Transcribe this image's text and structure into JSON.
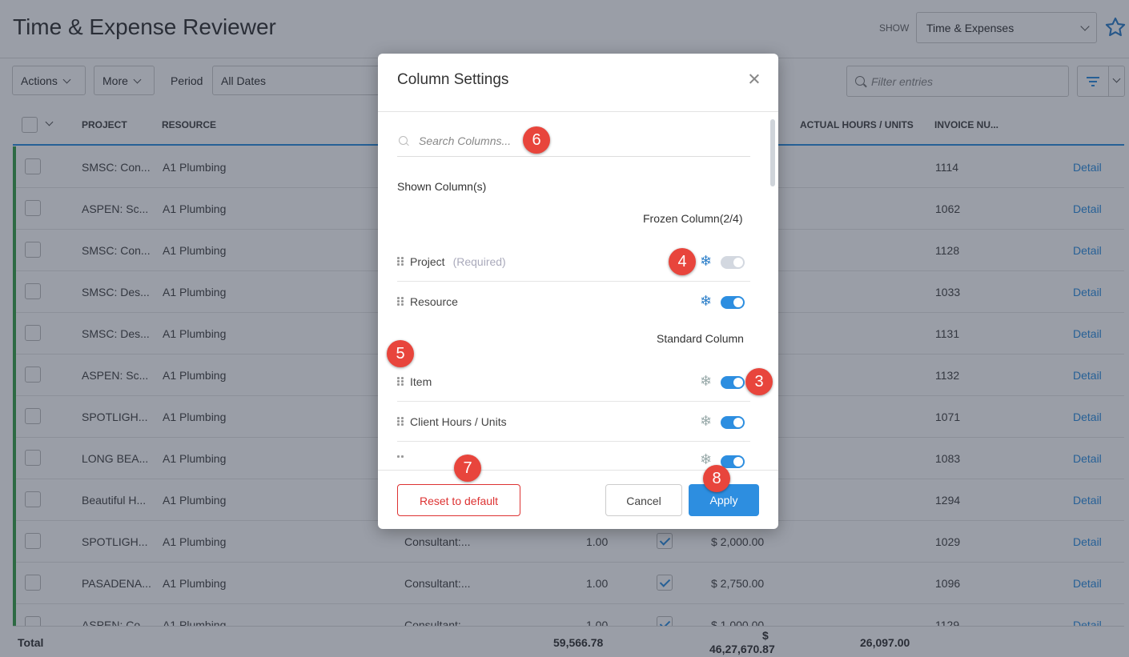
{
  "header": {
    "title": "Time & Expense Reviewer",
    "show_label": "SHOW",
    "show_value": "Time & Expenses"
  },
  "toolbar": {
    "actions_label": "Actions",
    "more_label": "More",
    "period_label": "Period",
    "period_value": "All Dates",
    "filter_placeholder": "Filter entries"
  },
  "table": {
    "columns": {
      "project": "PROJECT",
      "resource": "RESOURCE",
      "actual_hours": "ACTUAL HOURS / UNITS",
      "invoice": "INVOICE NU..."
    },
    "rows": [
      {
        "project": "SMSC: Con...",
        "resource": "A1 Plumbing",
        "item": "",
        "hours": "",
        "amount": "",
        "invoice": "1114",
        "link": "Detail"
      },
      {
        "project": "ASPEN: Sc...",
        "resource": "A1 Plumbing",
        "item": "",
        "hours": "",
        "amount": "",
        "invoice": "1062",
        "link": "Detail"
      },
      {
        "project": "SMSC: Con...",
        "resource": "A1 Plumbing",
        "item": "",
        "hours": "",
        "amount": "",
        "invoice": "1128",
        "link": "Detail"
      },
      {
        "project": "SMSC: Des...",
        "resource": "A1 Plumbing",
        "item": "",
        "hours": "",
        "amount": "",
        "invoice": "1033",
        "link": "Detail"
      },
      {
        "project": "SMSC: Des...",
        "resource": "A1 Plumbing",
        "item": "",
        "hours": "",
        "amount": "",
        "invoice": "1131",
        "link": "Detail"
      },
      {
        "project": "ASPEN: Sc...",
        "resource": "A1 Plumbing",
        "item": "",
        "hours": "",
        "amount": "",
        "invoice": "1132",
        "link": "Detail"
      },
      {
        "project": "SPOTLIGH...",
        "resource": "A1 Plumbing",
        "item": "",
        "hours": "",
        "amount": "",
        "invoice": "1071",
        "link": "Detail"
      },
      {
        "project": "LONG BEA...",
        "resource": "A1 Plumbing",
        "item": "",
        "hours": "",
        "amount": "",
        "invoice": "1083",
        "link": "Detail"
      },
      {
        "project": "Beautiful H...",
        "resource": "A1 Plumbing",
        "item": "",
        "hours": "",
        "amount": "",
        "invoice": "1294",
        "link": "Detail"
      },
      {
        "project": "SPOTLIGH...",
        "resource": "A1 Plumbing",
        "item": "Consultant:...",
        "hours": "1.00",
        "amount": "$ 2,000.00",
        "invoice": "1029",
        "link": "Detail"
      },
      {
        "project": "PASADENA...",
        "resource": "A1 Plumbing",
        "item": "Consultant:...",
        "hours": "1.00",
        "amount": "$ 2,750.00",
        "invoice": "1096",
        "link": "Detail"
      },
      {
        "project": "ASPEN: Co...",
        "resource": "A1 Plumbing",
        "item": "Consultant:...",
        "hours": "1.00",
        "amount": "$ 1,000.00",
        "invoice": "1129",
        "link": "Detail"
      }
    ],
    "total": {
      "label": "Total",
      "hours": "59,566.78",
      "amount_symbol": "$",
      "amount": "46,27,670.87",
      "actual": "26,097.00"
    }
  },
  "modal": {
    "title": "Column Settings",
    "search_placeholder": "Search Columns...",
    "shown_heading": "Shown Column(s)",
    "frozen_heading": "Frozen Column(2/4)",
    "standard_heading": "Standard Column",
    "frozen_columns": [
      {
        "label": "Project",
        "note": "(Required)"
      },
      {
        "label": "Resource",
        "note": ""
      }
    ],
    "standard_columns": [
      {
        "label": "Item"
      },
      {
        "label": "Client Hours / Units"
      }
    ],
    "reset_label": "Reset to default",
    "cancel_label": "Cancel",
    "apply_label": "Apply"
  },
  "badges": {
    "b3": "3",
    "b4": "4",
    "b5": "5",
    "b6": "6",
    "b7": "7",
    "b8": "8"
  },
  "colors": {
    "accent": "#2d8ee0",
    "danger": "#d33333",
    "badge": "#e8453c",
    "row_status": "#3aa14a"
  }
}
